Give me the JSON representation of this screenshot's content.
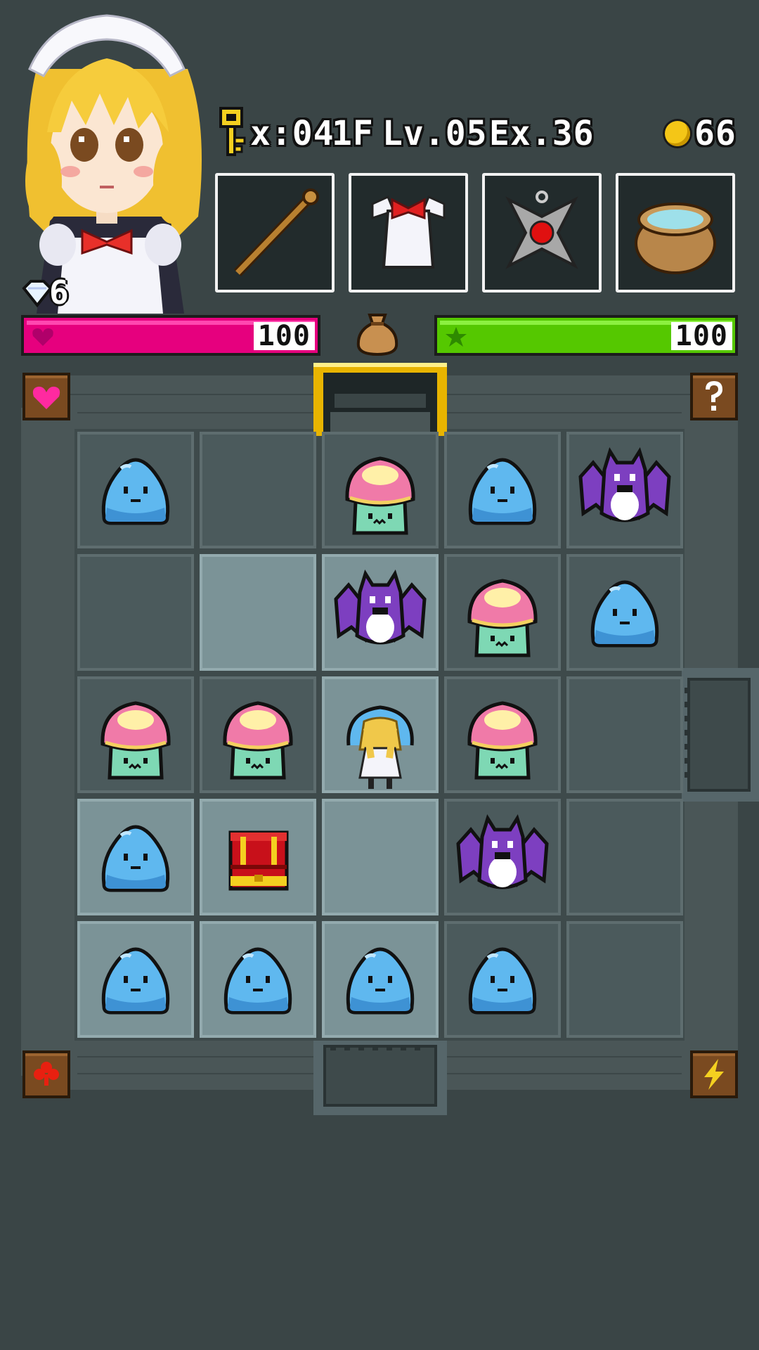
{
  "hud": {
    "gems": "6",
    "keys": "x:04",
    "floor": "1F",
    "level": "Lv.05",
    "exp": "Ex.36",
    "coins": "66",
    "hp": "100",
    "hp_fraction": 1.0,
    "xp": "100",
    "xp_fraction": 1.0
  },
  "equipment": [
    {
      "slot": "weapon",
      "icon": "wooden-staff-icon"
    },
    {
      "slot": "armor",
      "icon": "maid-apron-icon"
    },
    {
      "slot": "accessory",
      "icon": "red-gem-amulet-icon"
    },
    {
      "slot": "item",
      "icon": "water-pot-icon"
    }
  ],
  "dungeon": {
    "grid": [
      [
        "slime",
        "",
        "mushroom",
        "slime",
        "bat"
      ],
      [
        "",
        "",
        "bat",
        "mushroom",
        "slime"
      ],
      [
        "mushroom",
        "mushroom",
        "player",
        "mushroom",
        ""
      ],
      [
        "slime",
        "chest",
        "",
        "bat",
        ""
      ],
      [
        "slime",
        "slime",
        "slime",
        "slime",
        ""
      ]
    ],
    "tile_shades": [
      [
        "dark",
        "dark",
        "dark",
        "dark",
        "dark"
      ],
      [
        "dark",
        "light",
        "light",
        "dark",
        "dark"
      ],
      [
        "dark",
        "dark",
        "light",
        "dark",
        "dark"
      ],
      [
        "light",
        "light",
        "light",
        "dark",
        "dark"
      ],
      [
        "light",
        "light",
        "light",
        "dark",
        "dark"
      ]
    ]
  },
  "colors": {
    "background": "#3a4546",
    "hp_bar": "#e6007e",
    "xp_bar": "#55c800",
    "coin": "#f4c617",
    "slime": "#5fb8ef",
    "bat": "#7d3fc0",
    "mushroom_cap": "#f07aa8",
    "chest": "#c8101a"
  }
}
